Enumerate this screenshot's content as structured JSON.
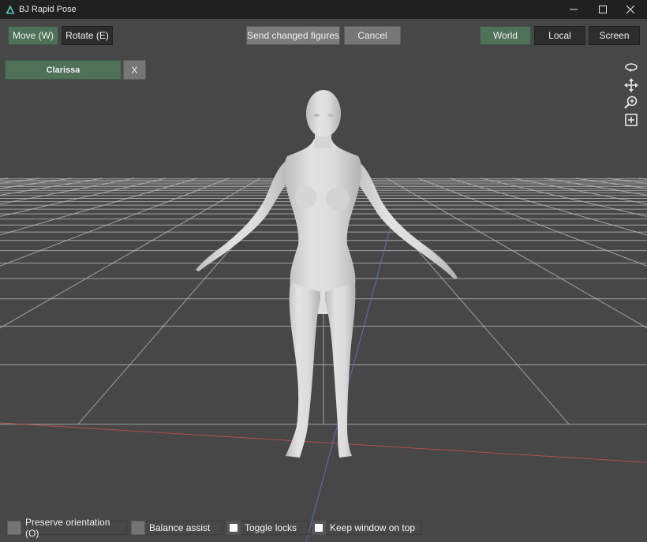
{
  "window": {
    "title": "BJ Rapid Pose",
    "controls": [
      "minimize-icon",
      "maximize-icon",
      "close-icon"
    ]
  },
  "toolbar": {
    "move_label": "Move (W)",
    "rotate_label": "Rotate (E)",
    "send_label": "Send changed figures",
    "cancel_label": "Cancel",
    "world_label": "World",
    "local_label": "Local",
    "screen_label": "Screen",
    "active_tool": "Move (W)",
    "active_space": "World"
  },
  "figure_tabs": [
    {
      "label": "Clarissa",
      "close_label": "X"
    }
  ],
  "nav_icons": [
    "orbit-icon",
    "pan-icon",
    "zoom-icon",
    "frame-icon"
  ],
  "options": [
    {
      "label": "Preserve orientation (O)",
      "checked": false
    },
    {
      "label": "Balance assist",
      "checked": false
    },
    {
      "label": "Toggle locks",
      "checked": true
    },
    {
      "label": "Keep window on top",
      "checked": true
    }
  ],
  "colors": {
    "active_button": "#4e7158",
    "viewport_background": "#474747",
    "titlebar": "#202020",
    "x_axis": "#c05050",
    "z_axis": "#6a6acb",
    "grid": "#bdbdbd",
    "figure": "#d9d9d9"
  }
}
